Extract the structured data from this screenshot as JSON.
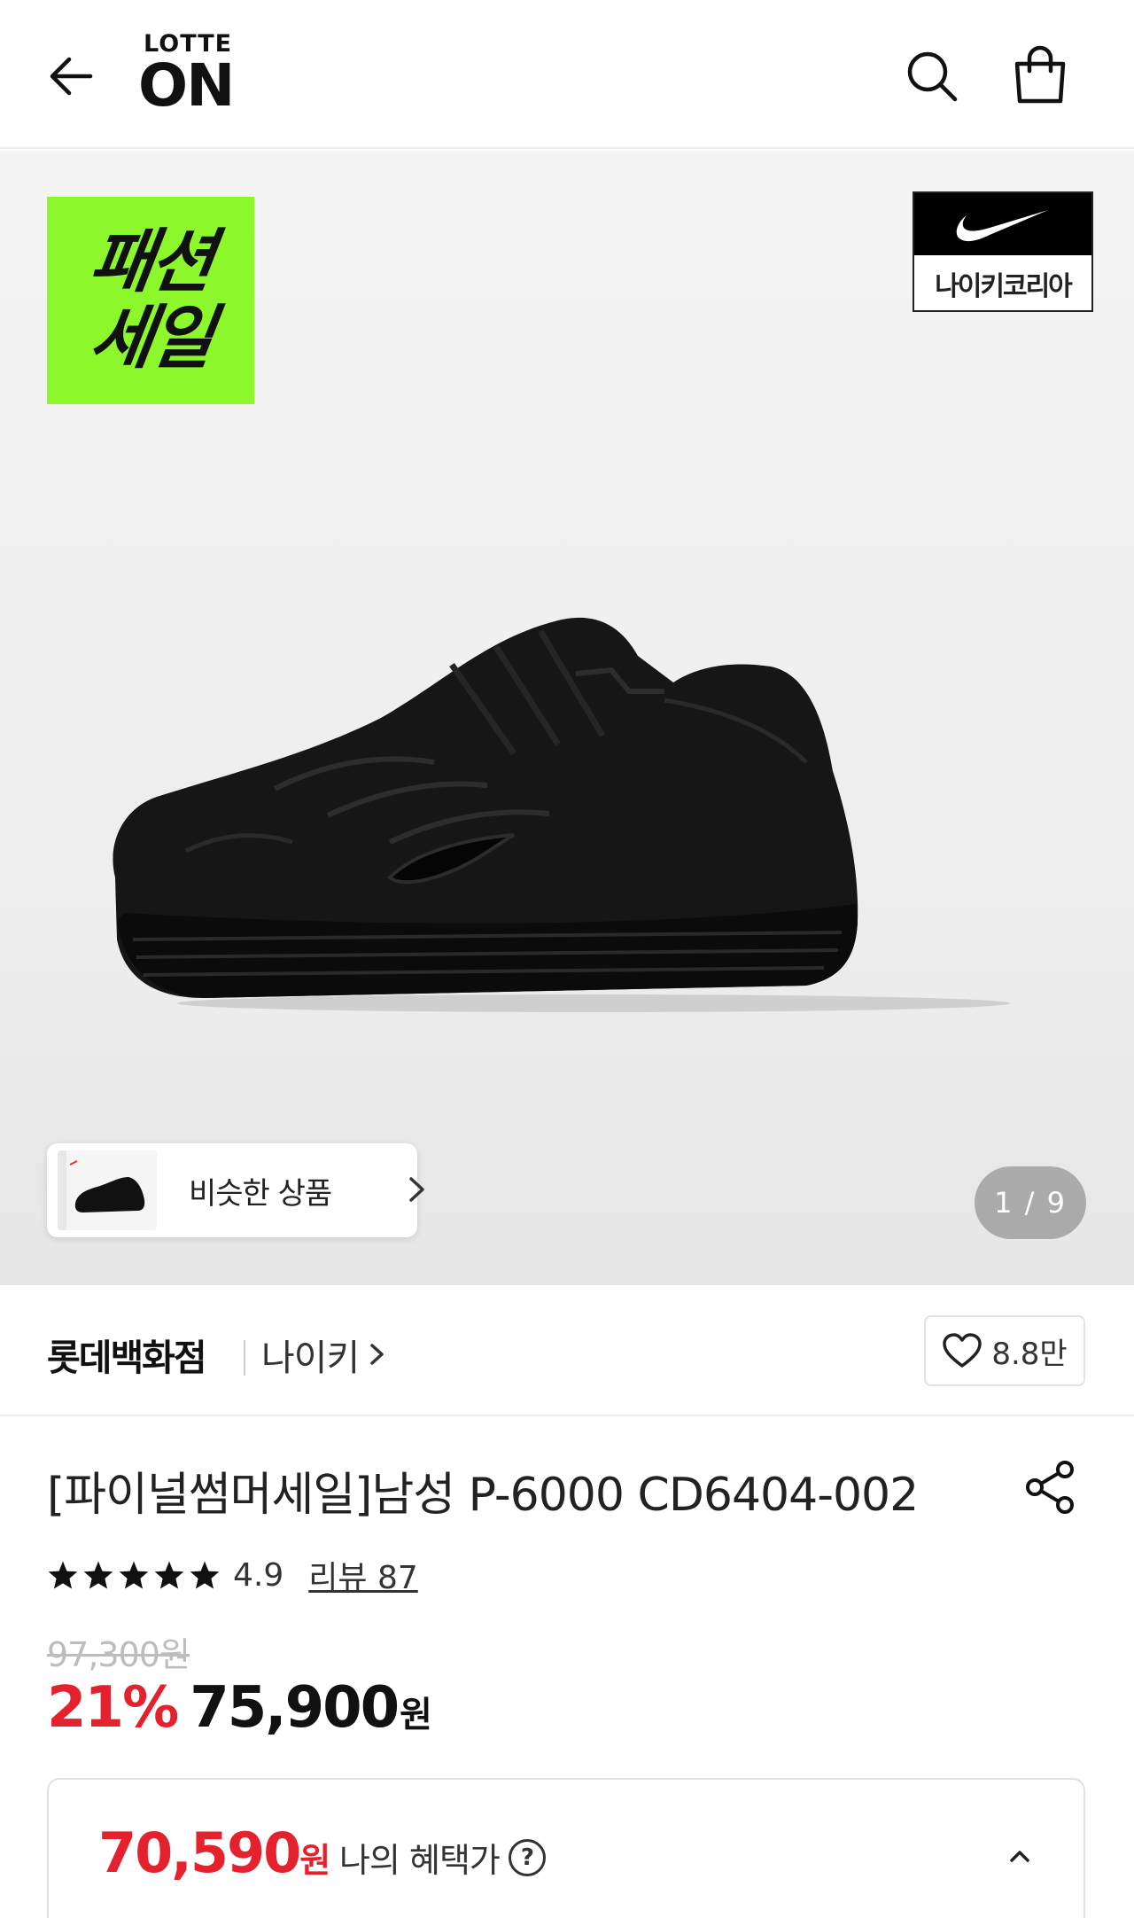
{
  "header": {
    "logo_top": "LOTTE",
    "logo_main": "ON",
    "icons": [
      "back-arrow-icon",
      "search-icon",
      "shopping-bag-icon"
    ]
  },
  "hero": {
    "sale_badge_line1": "패션",
    "sale_badge_line2": "세일",
    "sale_badge_color": "#8cf72a",
    "brand_badge_name": "나이키코리아",
    "similar_products_label": "비슷한 상품",
    "page_indicator": "1 / 9"
  },
  "store": {
    "store_name": "롯데백화점",
    "brand_link": "나이키",
    "like_count": "8.8만"
  },
  "product": {
    "title": "[파이널썸머세일]남성 P-6000 CD6404-002",
    "rating": "4.9",
    "star_count": 5,
    "review_link": "리뷰 87",
    "original_price": "97,300원",
    "discount_rate": "21%",
    "sale_price": "75,900",
    "currency": "원",
    "accent_color": "#e3222e"
  },
  "benefit": {
    "price": "70,590",
    "currency": "원",
    "label": "나의 혜택가",
    "help_icon_text": "?"
  }
}
